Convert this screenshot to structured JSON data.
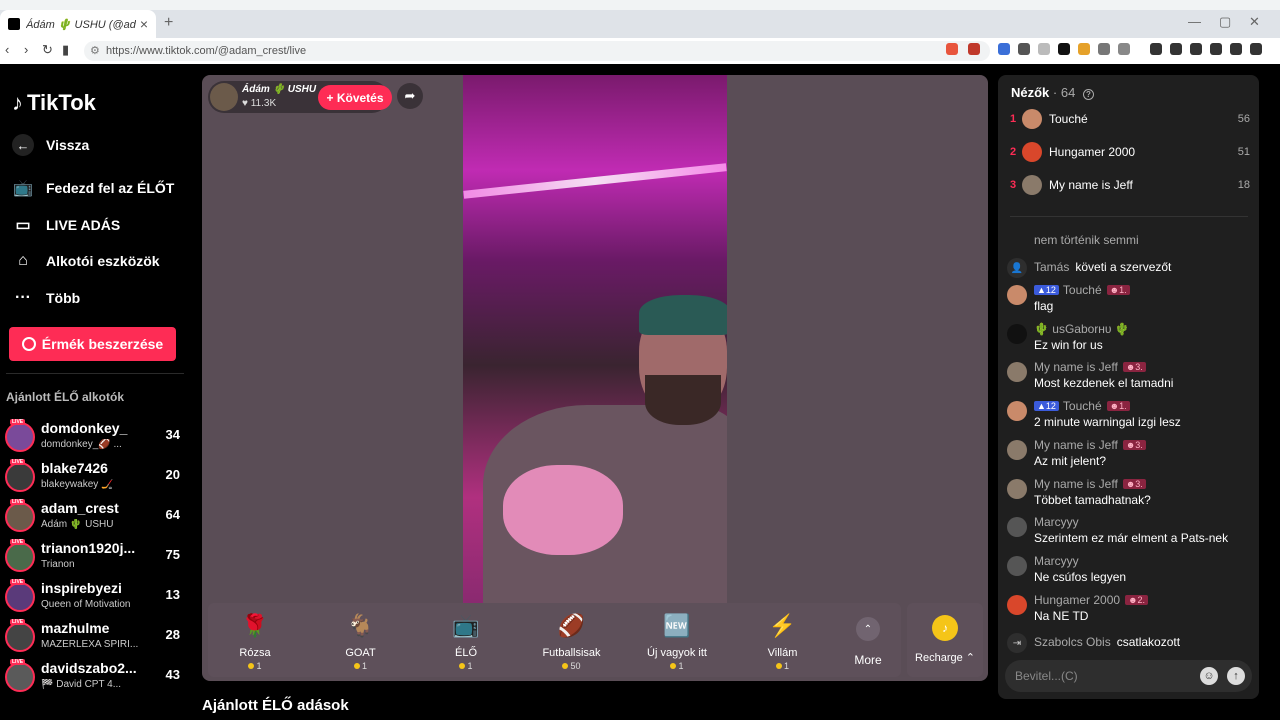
{
  "browser": {
    "tab_title": "Ádám 🌵 USHU (@adam_crest...",
    "url": "https://www.tiktok.com/@adam_crest/live"
  },
  "sidebar": {
    "logo": "TikTok",
    "back": "Vissza",
    "nav": [
      "Fedezd fel az ÉLŐT",
      "LIVE ADÁS",
      "Alkotói eszközök",
      "Több"
    ],
    "coins_button": "Érmék beszerzése",
    "suggested_title": "Ajánlott ÉLŐ alkotók",
    "live_badge": "LIVE",
    "creators": [
      {
        "name": "domdonkey_",
        "sub": "domdonkey_🏈 ...",
        "count": "34",
        "color": "#7a4a9a"
      },
      {
        "name": "blake7426",
        "sub": "blakeywakey 🏒",
        "count": "20",
        "color": "#3a3a3a"
      },
      {
        "name": "adam_crest",
        "sub": "Ádám 🌵 USHU",
        "count": "64",
        "color": "#6b5a4a"
      },
      {
        "name": "trianon1920j...",
        "sub": "Trianon",
        "count": "75",
        "color": "#4a6a4a"
      },
      {
        "name": "inspirebyezi",
        "sub": "Queen of Motivation",
        "count": "13",
        "color": "#5a3a7a"
      },
      {
        "name": "mazhulme",
        "sub": "MAZERLEXA SPIRI...",
        "count": "28",
        "color": "#444"
      },
      {
        "name": "davidszabo2...",
        "sub": "🏁 David CPT 4...",
        "count": "43",
        "color": "#5a5a5a"
      }
    ]
  },
  "host": {
    "name": "Ádám 🌵 USHU",
    "likes": "11.3K",
    "follow": "+ Követés"
  },
  "gifts": [
    {
      "name": "Rózsa",
      "price": "1",
      "icon": "🌹"
    },
    {
      "name": "GOAT",
      "price": "1",
      "icon": "🐐"
    },
    {
      "name": "ÉLŐ",
      "price": "1",
      "icon": "📺"
    },
    {
      "name": "Futballsisak",
      "price": "50",
      "icon": "🏈"
    },
    {
      "name": "Új vagyok itt",
      "price": "1",
      "icon": "🆕"
    },
    {
      "name": "Villám",
      "price": "1",
      "icon": "⚡"
    }
  ],
  "more_label": "More",
  "recharge_label": "Recharge ⌃",
  "recommended_title": "Ajánlott ÉLŐ adások",
  "chat": {
    "viewers_label": "Nézők",
    "viewers_count": "· 64",
    "top_viewers": [
      {
        "rank": "1",
        "name": "Touché",
        "score": "56",
        "color": "#c98a6a"
      },
      {
        "rank": "2",
        "name": "Hungamer 2000",
        "score": "51",
        "color": "#d9472b"
      },
      {
        "rank": "3",
        "name": "My name is Jeff",
        "score": "18",
        "color": "#8a7a6a"
      }
    ],
    "messages": [
      {
        "type": "system",
        "user": "",
        "text": "nem történik semmi"
      },
      {
        "type": "system",
        "user": "Tamás",
        "text": "követi a szervezőt"
      },
      {
        "type": "chat",
        "user": "Touché",
        "level": "12",
        "fan": "1.",
        "text": "flag",
        "color": "#c98a6a"
      },
      {
        "type": "chat",
        "user": "🌵 usGaborʜᴜ 🌵",
        "level": "",
        "fan": "",
        "text": "Ez win for us",
        "color": "#111"
      },
      {
        "type": "chat",
        "user": "My name is Jeff",
        "level": "",
        "fan": "3.",
        "text": "Most kezdenek el tamadni",
        "color": "#8a7a6a"
      },
      {
        "type": "chat",
        "user": "Touché",
        "level": "12",
        "fan": "1.",
        "text": "2 minute warningal izgi lesz",
        "color": "#c98a6a"
      },
      {
        "type": "chat",
        "user": "My name is Jeff",
        "level": "",
        "fan": "3.",
        "text": "Az mit jelent?",
        "color": "#8a7a6a"
      },
      {
        "type": "chat",
        "user": "My name is Jeff",
        "level": "",
        "fan": "3.",
        "text": "Többet tamadhatnak?",
        "color": "#8a7a6a"
      },
      {
        "type": "chat",
        "user": "Marcyyy",
        "level": "",
        "fan": "",
        "text": "Szerintem ez már elment a Pats-nek",
        "color": "#555"
      },
      {
        "type": "chat",
        "user": "Marcyyy",
        "level": "",
        "fan": "",
        "text": "Ne csúfos legyen",
        "color": "#555"
      },
      {
        "type": "chat",
        "user": "Hungamer 2000",
        "level": "",
        "fan": "2.",
        "text": "Na NE TD",
        "color": "#d9472b"
      },
      {
        "type": "join",
        "user": "Szabolcs Obis",
        "text": "csatlakozott"
      }
    ],
    "input_placeholder": "Bevitel...(C)"
  }
}
